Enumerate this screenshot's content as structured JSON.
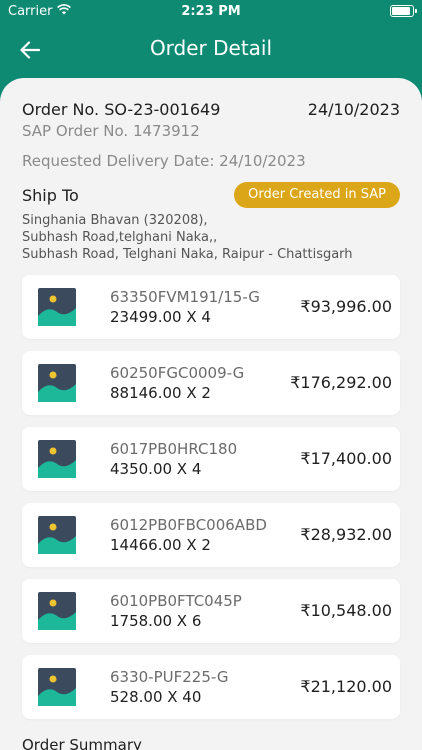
{
  "status_bar": {
    "carrier": "Carrier",
    "time": "2:23 PM"
  },
  "nav": {
    "title": "Order Detail"
  },
  "order": {
    "order_no": "Order No. SO-23-001649",
    "date": "24/10/2023",
    "sap_order": "SAP Order No. 1473912",
    "delivery": "Requested Delivery Date: 24/10/2023",
    "ship_to_label": "Ship To",
    "status": "Order Created in SAP",
    "address_line1": "Singhania Bhavan (320208),",
    "address_line2": "Subhash Road,telghani Naka,,",
    "address_line3": "Subhash Road, Telghani Naka, Raipur - Chattisgarh"
  },
  "items": [
    {
      "sku": "63350FVM191/15-G",
      "qty": "23499.00 X 4",
      "amount": "₹93,996.00"
    },
    {
      "sku": "60250FGC0009-G",
      "qty": "88146.00 X 2",
      "amount": "₹176,292.00"
    },
    {
      "sku": "6017PB0HRC180",
      "qty": "4350.00 X 4",
      "amount": "₹17,400.00"
    },
    {
      "sku": "6012PB0FBC006ABD",
      "qty": "14466.00 X 2",
      "amount": "₹28,932.00"
    },
    {
      "sku": "6010PB0FTC045P",
      "qty": "1758.00 X 6",
      "amount": "₹10,548.00"
    },
    {
      "sku": "6330-PUF225-G",
      "qty": "528.00 X 40",
      "amount": "₹21,120.00"
    }
  ],
  "summary_title": "Order Summary",
  "colors": {
    "primary": "#0e8a73",
    "badge": "#dba617",
    "thumb_bg": "#3c4a5e",
    "thumb_hill": "#1db79a",
    "thumb_sun": "#f0c431"
  }
}
